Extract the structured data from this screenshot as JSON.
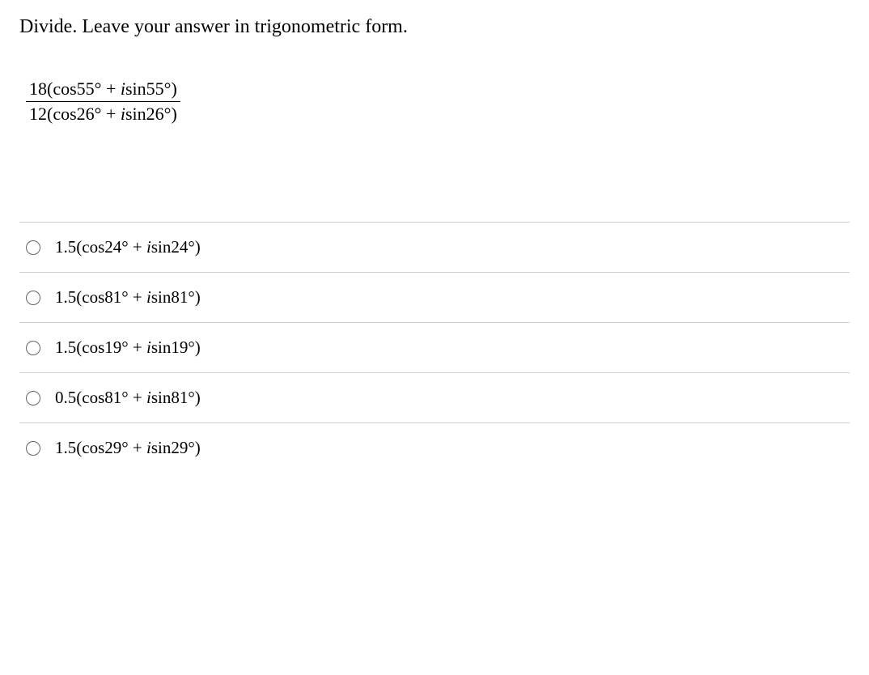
{
  "question": {
    "prompt": "Divide. Leave your answer in trigonometric form.",
    "expression": {
      "numerator": "18(cos55° + isin55°)",
      "denominator": "12(cos26° + isin26°)"
    }
  },
  "options": [
    {
      "text": "1.5(cos24° + isin24°)"
    },
    {
      "text": "1.5(cos81° + isin81°)"
    },
    {
      "text": "1.5(cos19° + isin19°)"
    },
    {
      "text": "0.5(cos81° + isin81°)"
    },
    {
      "text": "1.5(cos29° + isin29°)"
    }
  ]
}
